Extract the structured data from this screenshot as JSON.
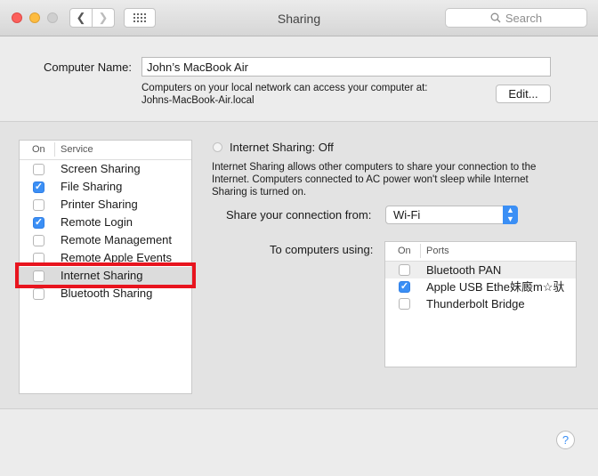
{
  "window": {
    "title": "Sharing"
  },
  "toolbar": {
    "search_placeholder": "Search"
  },
  "computer": {
    "name_label": "Computer Name:",
    "name_value": "John’s MacBook Air",
    "network_note": "Computers on your local network can access your computer at:",
    "hostname": "Johns-MacBook-Air.local",
    "edit_label": "Edit..."
  },
  "services": {
    "col_on": "On",
    "col_service": "Service",
    "items": [
      {
        "label": "Screen Sharing",
        "checked": false
      },
      {
        "label": "File Sharing",
        "checked": true
      },
      {
        "label": "Printer Sharing",
        "checked": false
      },
      {
        "label": "Remote Login",
        "checked": true
      },
      {
        "label": "Remote Management",
        "checked": false
      },
      {
        "label": "Remote Apple Events",
        "checked": false
      },
      {
        "label": "Internet Sharing",
        "checked": false
      },
      {
        "label": "Bluetooth Sharing",
        "checked": false
      }
    ]
  },
  "detail": {
    "status": "Internet Sharing: Off",
    "description": "Internet Sharing allows other computers to share your connection to the Internet. Computers connected to AC power won't sleep while Internet Sharing is turned on.",
    "share_from_label": "Share your connection from:",
    "share_from_value": "Wi-Fi",
    "to_computers_label": "To computers using:",
    "ports_col_on": "On",
    "ports_col_ports": "Ports",
    "ports": [
      {
        "label": "Bluetooth PAN",
        "checked": false
      },
      {
        "label": "Apple USB Ethe妹廄m☆驮",
        "checked": true
      },
      {
        "label": "Thunderbolt Bridge",
        "checked": false
      }
    ]
  },
  "help_label": "?",
  "colors": {
    "accent": "#3b8ff5",
    "highlight": "#e8141e"
  }
}
